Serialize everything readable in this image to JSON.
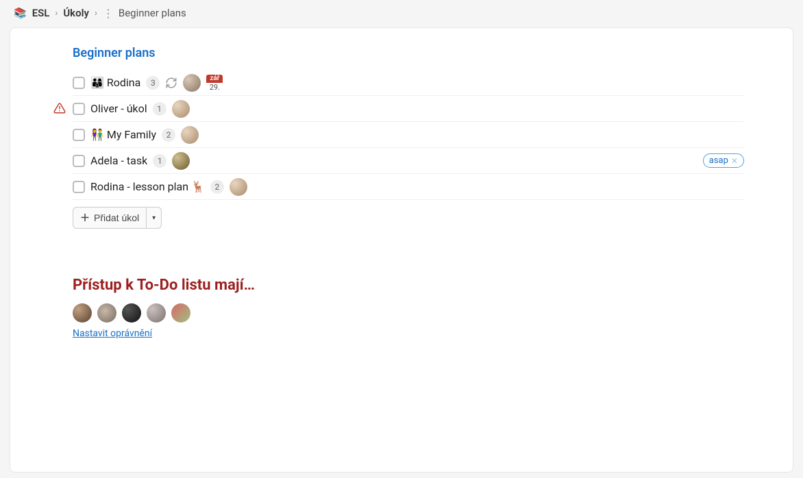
{
  "breadcrumb": {
    "emoji": "📚",
    "workspace": "ESL",
    "section": "Úkoly",
    "current": "Beginner plans"
  },
  "list": {
    "title": "Beginner plans",
    "tasks": [
      {
        "emoji": "👨‍👩‍👦",
        "title": "Rodina",
        "count": "3",
        "has_refresh": true,
        "has_warning": false,
        "date": {
          "month": "zář",
          "day": "29."
        },
        "tag": null
      },
      {
        "emoji": "",
        "title": "Oliver - úkol",
        "count": "1",
        "has_refresh": false,
        "has_warning": true,
        "date": null,
        "tag": null
      },
      {
        "emoji": "👫",
        "title": "My Family",
        "count": "2",
        "has_refresh": false,
        "has_warning": false,
        "date": null,
        "tag": null
      },
      {
        "emoji": "",
        "title": "Adela - task",
        "count": "1",
        "has_refresh": false,
        "has_warning": false,
        "date": null,
        "tag": "asap"
      },
      {
        "emoji": "",
        "title": "Rodina - lesson plan 🦌",
        "count": "2",
        "has_refresh": false,
        "has_warning": false,
        "date": null,
        "tag": null
      }
    ],
    "add_label": "Přidat úkol"
  },
  "access": {
    "heading": "Přístup k To-Do listu mají…",
    "link": "Nastavit oprávnění"
  }
}
